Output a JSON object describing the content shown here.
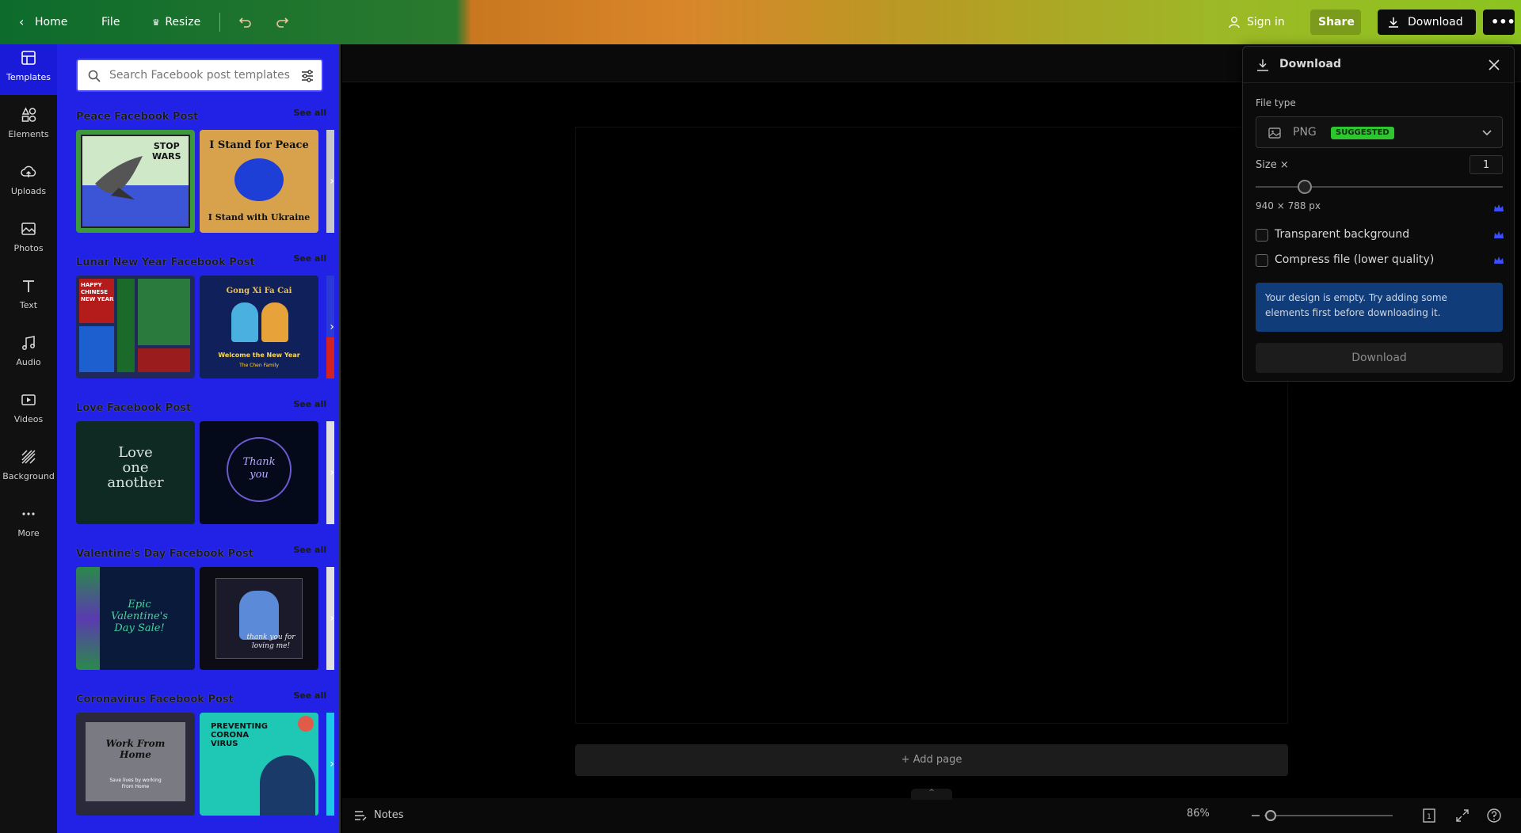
{
  "topbar": {
    "home_label": "Home",
    "file_label": "File",
    "resize_label": "Resize",
    "signin_label": "Sign in",
    "share_label": "Share",
    "download_label": "Download"
  },
  "leftnav": {
    "items": [
      {
        "label": "Templates",
        "icon": "templates-icon"
      },
      {
        "label": "Elements",
        "icon": "elements-icon"
      },
      {
        "label": "Uploads",
        "icon": "upload-cloud-icon"
      },
      {
        "label": "Photos",
        "icon": "photo-icon"
      },
      {
        "label": "Text",
        "icon": "text-icon"
      },
      {
        "label": "Audio",
        "icon": "music-note-icon"
      },
      {
        "label": "Videos",
        "icon": "video-icon"
      },
      {
        "label": "Background",
        "icon": "background-hatch-icon"
      },
      {
        "label": "More",
        "icon": "more-dots-icon"
      }
    ]
  },
  "panel": {
    "search_placeholder": "Search Facebook post templates",
    "sections": [
      {
        "title": "Peace Facebook Post",
        "see_all": "See all",
        "thumbs": [
          {
            "lines": [
              "STOP",
              "WARS"
            ]
          },
          {
            "top": "I Stand for Peace",
            "bottom": "I Stand with Ukraine"
          }
        ]
      },
      {
        "title": "Lunar New Year Facebook Post",
        "see_all": "See all",
        "thumbs": [
          {
            "lines": [
              "HAPPY",
              "CHINESE",
              "NEW YEAR"
            ]
          },
          {
            "top": "Gong Xi Fa Cai",
            "bottom": "Welcome the New Year",
            "sub": "The Chen Family"
          }
        ]
      },
      {
        "title": "Love Facebook Post",
        "see_all": "See all",
        "thumbs": [
          {
            "lines": [
              "Love",
              "one",
              "another"
            ]
          },
          {
            "lines": [
              "Thank",
              "you"
            ]
          }
        ]
      },
      {
        "title": "Valentine's Day Facebook Post",
        "see_all": "See all",
        "thumbs": [
          {
            "lines": [
              "Epic",
              "Valentine's",
              "Day Sale!"
            ]
          },
          {
            "lines": [
              "thank you for",
              "loving me!"
            ]
          }
        ]
      },
      {
        "title": "Coronavirus Facebook Post",
        "see_all": "See all",
        "thumbs": [
          {
            "lines": [
              "Work From",
              "Home"
            ],
            "sub": "Save lives by working From Home"
          },
          {
            "lines": [
              "PREVENTING",
              "CORONA",
              "VIRUS"
            ]
          }
        ]
      }
    ]
  },
  "canvas": {
    "add_page_label": "+ Add page",
    "notes_label": "Notes",
    "zoom_label": "86%",
    "zoom_fraction": 0.05
  },
  "download_panel": {
    "title": "Download",
    "file_type_label": "File type",
    "file_type_value": "PNG",
    "suggested_badge": "SUGGESTED",
    "size_label": "Size ×",
    "size_value": "1",
    "size_fraction": 0.2,
    "dimensions": "940 × 788 px",
    "transparent_label": "Transparent background",
    "compress_label": "Compress file (lower quality)",
    "notice": "Your design is empty. Try adding some elements first before downloading it.",
    "submit_label": "Download"
  },
  "colors": {
    "panel_bg": "#2222e6",
    "accent_green": "#2ec62e",
    "notice_bg": "#103c7a",
    "crown": "#3a4dff"
  }
}
